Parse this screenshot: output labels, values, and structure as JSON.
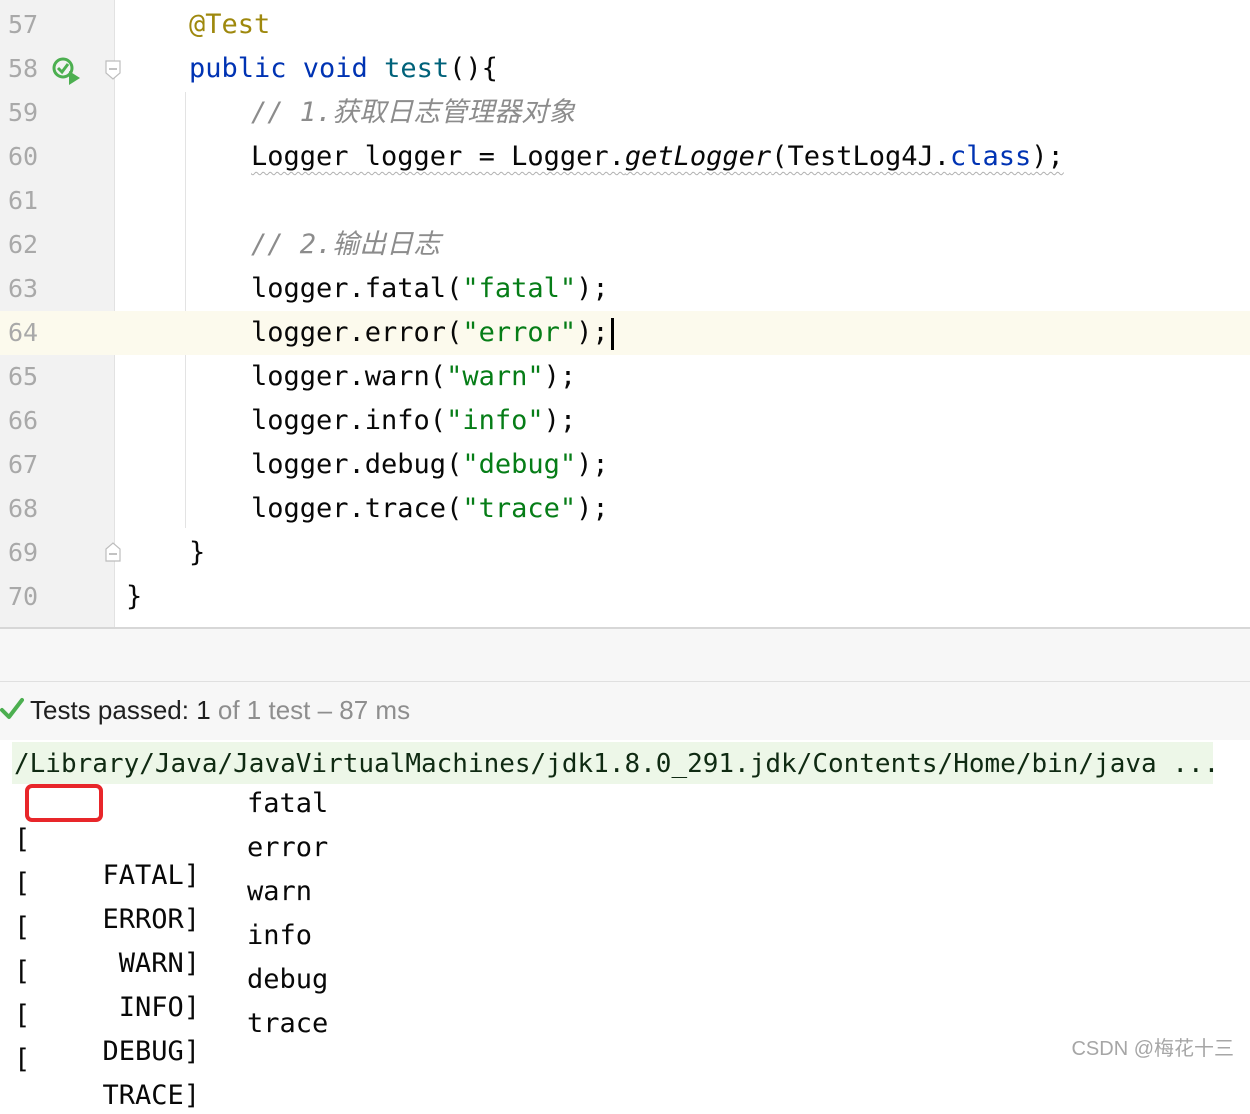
{
  "editor": {
    "lines": [
      {
        "num": "57"
      },
      {
        "num": "58"
      },
      {
        "num": "59"
      },
      {
        "num": "60"
      },
      {
        "num": "61"
      },
      {
        "num": "62"
      },
      {
        "num": "63"
      },
      {
        "num": "64"
      },
      {
        "num": "65"
      },
      {
        "num": "66"
      },
      {
        "num": "67"
      },
      {
        "num": "68"
      },
      {
        "num": "69"
      },
      {
        "num": "70"
      }
    ],
    "code": {
      "l57": "@Test",
      "l58_kw": "public void",
      "l58_fn": "test",
      "l58_rest": "(){",
      "l59": "// 1.获取日志管理器对象",
      "l60_a": "Logger logger = Logger.",
      "l60_b": "getLogger",
      "l60_c": "(TestLog4J.",
      "l60_d": "class",
      "l60_e": ");",
      "l62": "// 2.输出日志",
      "l63_a": "logger.fatal(",
      "l63_s": "\"fatal\"",
      "l63_b": ");",
      "l64_a": "logger.error(",
      "l64_s": "\"error\"",
      "l64_b": ");",
      "l65_a": "logger.warn(",
      "l65_s": "\"warn\"",
      "l65_b": ");",
      "l66_a": "logger.info(",
      "l66_s": "\"info\"",
      "l66_b": ");",
      "l67_a": "logger.debug(",
      "l67_s": "\"debug\"",
      "l67_b": ");",
      "l68_a": "logger.trace(",
      "l68_s": "\"trace\"",
      "l68_b": ");",
      "l69": "}",
      "l70": "}"
    }
  },
  "status": {
    "label": "Tests passed: 1",
    "detail": " of 1 test – 87 ms"
  },
  "console": {
    "command": "/Library/Java/JavaVirtualMachines/jdk1.8.0_291.jdk/Contents/Home/bin/java ...",
    "rows": [
      {
        "open": "[",
        "level": "FATAL]",
        "msg": "fatal"
      },
      {
        "open": "[",
        "level": "ERROR]",
        "msg": "error"
      },
      {
        "open": "[",
        "level": "WARN]",
        "msg": "warn"
      },
      {
        "open": "[",
        "level": "INFO]",
        "msg": "info"
      },
      {
        "open": "[",
        "level": "DEBUG]",
        "msg": "debug"
      },
      {
        "open": "[",
        "level": "TRACE]",
        "msg": "trace"
      }
    ]
  },
  "watermark": "CSDN @梅花十三",
  "colors": {
    "keyword": "#0033b3",
    "string": "#067d17",
    "annotation": "#9e880d",
    "comment": "#8c8c8c",
    "highlight": "#e8262a",
    "pass": "#4caf50"
  }
}
